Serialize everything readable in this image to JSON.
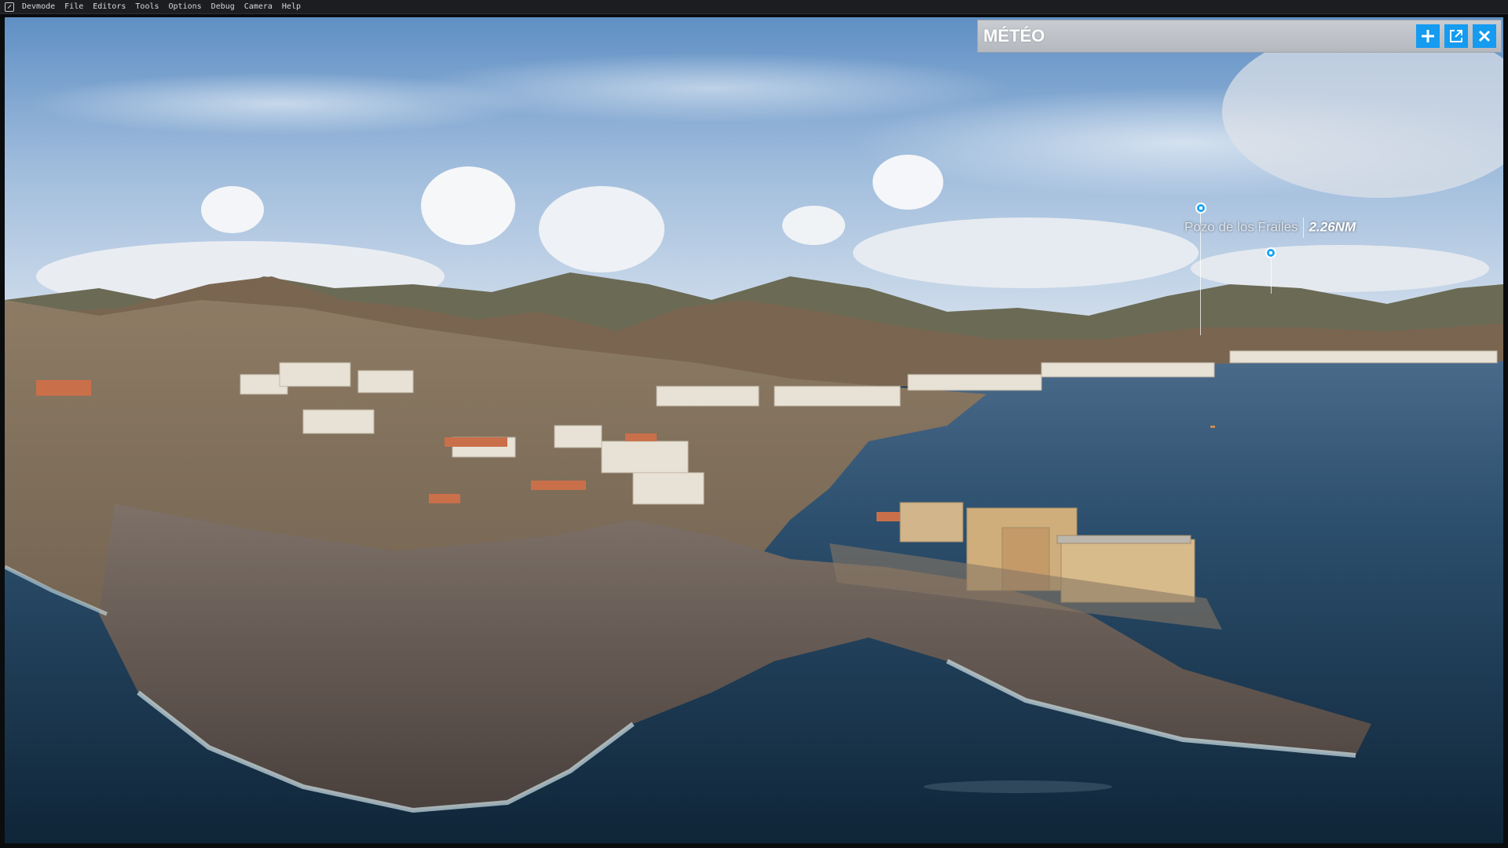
{
  "menubar": {
    "items": [
      "Devmode",
      "File",
      "Editors",
      "Tools",
      "Options",
      "Debug",
      "Camera",
      "Help"
    ]
  },
  "meteo_panel": {
    "title": "MÉTÉO",
    "buttons": [
      {
        "name": "add-button",
        "icon": "plus-icon"
      },
      {
        "name": "undock-button",
        "icon": "external-window-icon"
      },
      {
        "name": "close-button",
        "icon": "close-icon"
      }
    ]
  },
  "poi": {
    "name": "Pozo de los Frailes",
    "distance": "2.26NM"
  },
  "colors": {
    "accent": "#159bf0",
    "panel": "#bfc3c8",
    "menubar": "#1c1d20"
  }
}
